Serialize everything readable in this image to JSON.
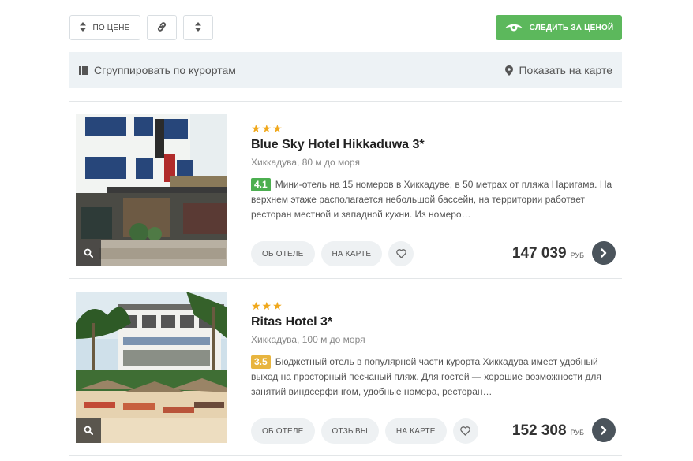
{
  "toolbar": {
    "sort_label": "ПО ЦЕНЕ",
    "follow_label": "СЛЕДИТЬ ЗА ЦЕНОЙ"
  },
  "groupbar": {
    "group_label": "Сгруппировать по курортам",
    "map_label": "Показать на карте"
  },
  "colors": {
    "accent_green": "#5cb85c",
    "star": "#f0a81c",
    "groupbar_bg": "#edf2f5"
  },
  "hotels": [
    {
      "stars": "★★★",
      "name": "Blue Sky Hotel Hikkaduwa 3*",
      "location": "Хиккадува, 80 м до моря",
      "rating": "4.1",
      "description": "Мини-отель на 15 номеров в Хиккадуве, в 50 метрах от пляжа Наригама. На верхнем этаже располагается небольшой бассейн, на территории работает ресторан местной и западной кухни. Из номеро…",
      "btn_about": "ОБ ОТЕЛЕ",
      "btn_map": "НА КАРТЕ",
      "price": "147 039",
      "currency": "РУБ"
    },
    {
      "stars": "★★★",
      "name": "Ritas Hotel 3*",
      "location": "Хиккадува, 100 м до моря",
      "rating": "3.5",
      "description": "Бюджетный отель в популярной части курорта Хиккадува имеет удобный выход на просторный песчаный пляж. Для гостей — хорошие возможности для занятий виндсерфингом, удобные номера, ресторан…",
      "btn_about": "ОБ ОТЕЛЕ",
      "btn_reviews": "ОТЗЫВЫ",
      "btn_map": "НА КАРТЕ",
      "price": "152 308",
      "currency": "РУБ"
    }
  ]
}
